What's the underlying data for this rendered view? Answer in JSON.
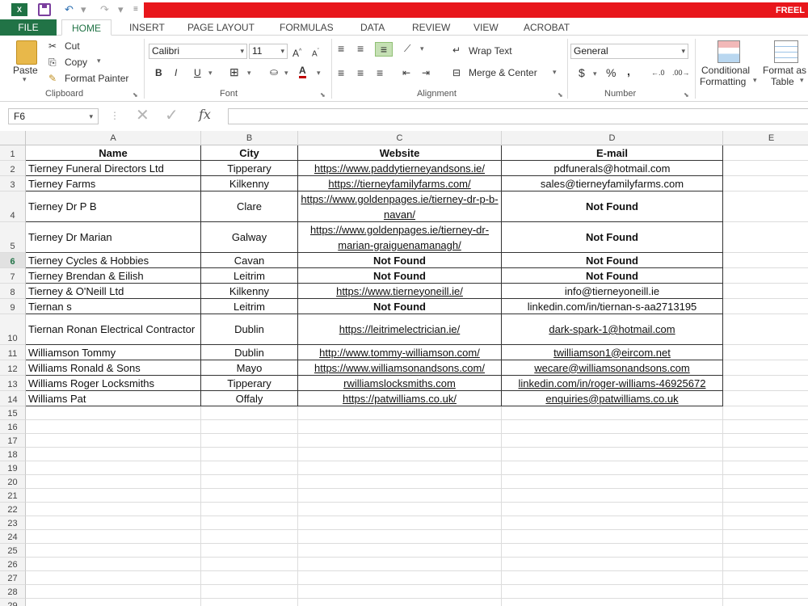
{
  "window": {
    "app_logo": "X",
    "title_text": "FREEL"
  },
  "quick_access": {
    "undo": "↶",
    "redo": "↷"
  },
  "ribbon_tabs": [
    "FILE",
    "HOME",
    "INSERT",
    "PAGE LAYOUT",
    "FORMULAS",
    "DATA",
    "REVIEW",
    "VIEW",
    "ACROBAT"
  ],
  "clipboard": {
    "paste": "Paste",
    "cut": "Cut",
    "copy": "Copy",
    "format_painter": "Format Painter",
    "label": "Clipboard"
  },
  "font": {
    "name": "Calibri",
    "size": "11",
    "bold": "B",
    "italic": "I",
    "underline": "U",
    "label": "Font"
  },
  "alignment": {
    "wrap_text": "Wrap Text",
    "merge_center": "Merge & Center",
    "label": "Alignment"
  },
  "number": {
    "format": "General",
    "currency": "$",
    "percent": "%",
    "comma": ",",
    "label": "Number"
  },
  "styles": {
    "conditional_1": "Conditional",
    "conditional_2": "Formatting",
    "format_as_1": "Format as",
    "format_as_2": "Table"
  },
  "formula_bar": {
    "name_box": "F6",
    "fx": "fx",
    "value": ""
  },
  "columns": [
    "A",
    "B",
    "C",
    "D",
    "E"
  ],
  "row_numbers": [
    "1",
    "2",
    "3",
    "4",
    "5",
    "6",
    "7",
    "8",
    "9",
    "10",
    "11",
    "12",
    "13",
    "14",
    "15",
    "16",
    "17",
    "18",
    "19",
    "20",
    "21",
    "22",
    "23",
    "24",
    "25",
    "26",
    "27",
    "28",
    "29"
  ],
  "selected_cell": "F6",
  "table": {
    "headers": [
      "Name",
      "City",
      "Website",
      "E-mail"
    ],
    "rows": [
      [
        "Tierney Funeral Directors Ltd",
        "Tipperary",
        "https://www.paddytierneyandsons.ie/",
        "pdfunerals@hotmail.com"
      ],
      [
        "Tierney Farms",
        "Kilkenny",
        "https://tierneyfamilyfarms.com/",
        "sales@tierneyfamilyfarms.com"
      ],
      [
        "Tierney Dr P B",
        "Clare",
        "https://www.goldenpages.ie/tierney-dr-p-b-navan/",
        "Not Found"
      ],
      [
        "Tierney Dr Marian",
        "Galway",
        "https://www.goldenpages.ie/tierney-dr-marian-graiguenamanagh/",
        "Not Found"
      ],
      [
        "Tierney Cycles & Hobbies",
        "Cavan",
        "Not Found",
        "Not Found"
      ],
      [
        "Tierney Brendan & Eilish",
        "Leitrim",
        "Not Found",
        "Not Found"
      ],
      [
        "Tierney & O'Neill Ltd",
        "Kilkenny",
        "https://www.tierneyoneill.ie/",
        "info@tierneyoneill.ie"
      ],
      [
        "Tiernan s",
        "Leitrim",
        "Not Found",
        "linkedin.com/in/tiernan-s-aa2713195"
      ],
      [
        "Tiernan Ronan Electrical Contractor",
        "Dublin",
        "https://leitrimelectrician.ie/",
        "dark-spark-1@hotmail.com"
      ],
      [
        "Williamson Tommy",
        "Dublin",
        "http://www.tommy-williamson.com/",
        "twilliamson1@eircom.net"
      ],
      [
        "Williams Ronald & Sons",
        "Mayo",
        "https://www.williamsonandsons.com/",
        "wecare@williamsonandsons.com"
      ],
      [
        "Williams Roger Locksmiths",
        "Tipperary",
        "rwilliamslocksmiths.com",
        "linkedin.com/in/roger-williams-46925672"
      ],
      [
        "Williams Pat",
        "Offaly",
        "https://patwilliams.co.uk/",
        "enquiries@patwilliams.co.uk"
      ]
    ]
  }
}
